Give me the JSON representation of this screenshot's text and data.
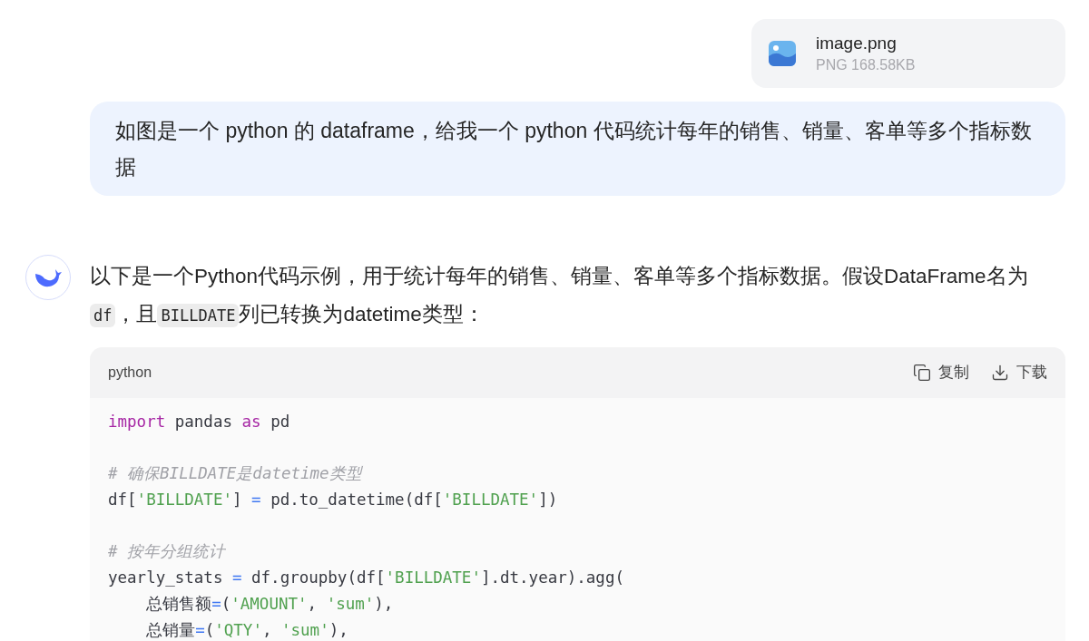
{
  "attachment": {
    "name": "image.png",
    "meta": "PNG 168.58KB"
  },
  "user_message": "如图是一个 python 的 dataframe，给我一个 python 代码统计每年的销售、销量、客单等多个指标数据",
  "assistant_message": [
    {
      "kind": "text",
      "text": "以下是一个Python代码示例，用于统计每年的销售、销量、客单等多个指标数据。假设DataFrame名为"
    },
    {
      "kind": "code",
      "text": "df"
    },
    {
      "kind": "text",
      "text": "，且"
    },
    {
      "kind": "code",
      "text": "BILLDATE"
    },
    {
      "kind": "text",
      "text": "列已转换为datetime类型："
    }
  ],
  "code_block": {
    "language": "python",
    "actions": [
      {
        "kind": "copy",
        "label": "复制"
      },
      {
        "kind": "download",
        "label": "下载"
      }
    ],
    "blocks": [
      {
        "lines": [
          [
            {
              "kind": "keyword",
              "text": "import"
            },
            {
              "kind": "plain",
              "text": " pandas "
            },
            {
              "kind": "keyword",
              "text": "as"
            },
            {
              "kind": "plain",
              "text": " pd"
            }
          ]
        ]
      },
      {
        "lines": [
          [
            {
              "kind": "comment",
              "text": "# 确保BILLDATE是datetime类型"
            }
          ],
          [
            {
              "kind": "plain",
              "text": "df["
            },
            {
              "kind": "string",
              "text": "'BILLDATE'"
            },
            {
              "kind": "plain",
              "text": "] "
            },
            {
              "kind": "operator",
              "text": "="
            },
            {
              "kind": "plain",
              "text": " pd.to_datetime(df["
            },
            {
              "kind": "string",
              "text": "'BILLDATE'"
            },
            {
              "kind": "plain",
              "text": "])"
            }
          ]
        ]
      },
      {
        "lines": [
          [
            {
              "kind": "comment",
              "text": "# 按年分组统计"
            }
          ],
          [
            {
              "kind": "plain",
              "text": "yearly_stats "
            },
            {
              "kind": "operator",
              "text": "="
            },
            {
              "kind": "plain",
              "text": " df.groupby(df["
            },
            {
              "kind": "string",
              "text": "'BILLDATE'"
            },
            {
              "kind": "plain",
              "text": "].dt.year).agg("
            }
          ],
          [
            {
              "kind": "plain",
              "text": "    总销售额"
            },
            {
              "kind": "operator",
              "text": "="
            },
            {
              "kind": "plain",
              "text": "("
            },
            {
              "kind": "string",
              "text": "'AMOUNT'"
            },
            {
              "kind": "plain",
              "text": ", "
            },
            {
              "kind": "string",
              "text": "'sum'"
            },
            {
              "kind": "plain",
              "text": "),"
            }
          ],
          [
            {
              "kind": "plain",
              "text": "    总销量"
            },
            {
              "kind": "operator",
              "text": "="
            },
            {
              "kind": "plain",
              "text": "("
            },
            {
              "kind": "string",
              "text": "'QTY'"
            },
            {
              "kind": "plain",
              "text": ", "
            },
            {
              "kind": "string",
              "text": "'sum'"
            },
            {
              "kind": "plain",
              "text": "),"
            }
          ]
        ]
      }
    ]
  }
}
